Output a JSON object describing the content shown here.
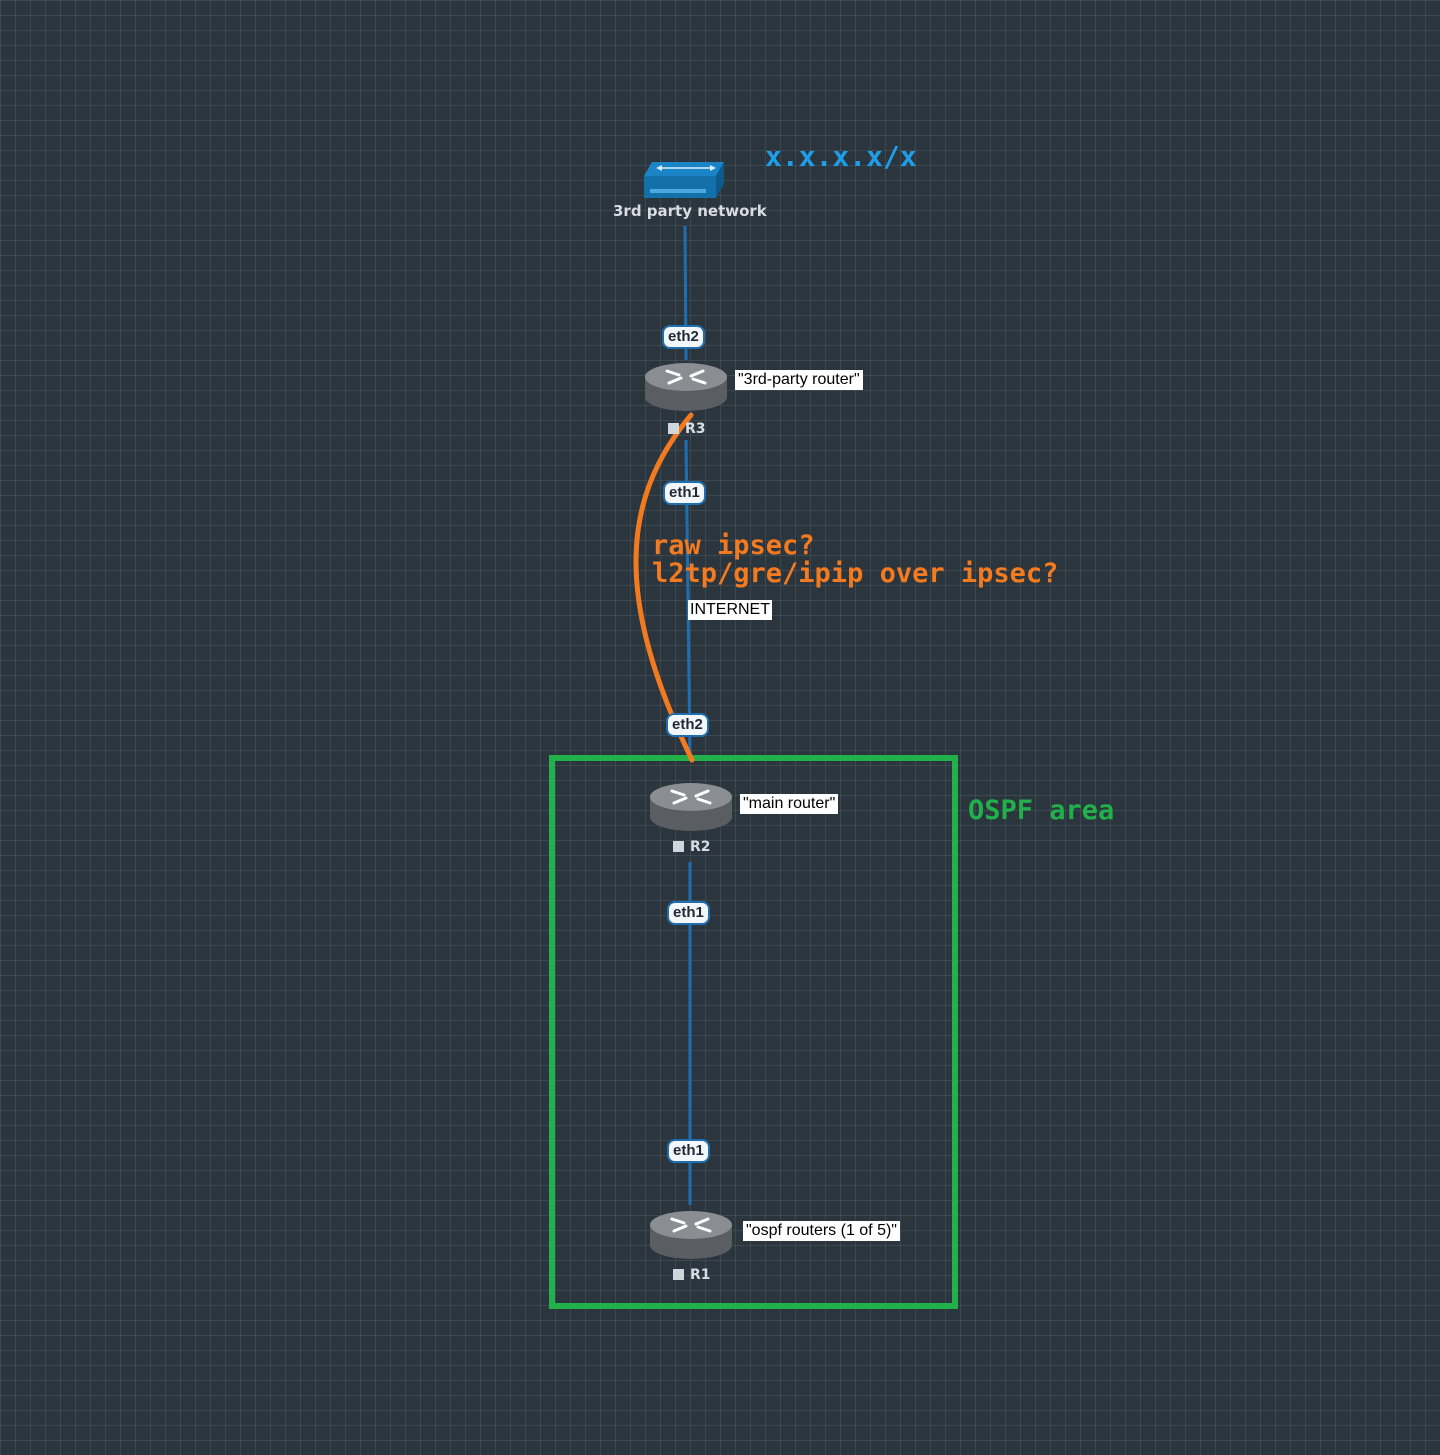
{
  "network": {
    "label": "3rd party network",
    "subnet": "x.x.x.x/x"
  },
  "routers": [
    {
      "id": "R3",
      "description": "\"3rd-party router\""
    },
    {
      "id": "R2",
      "description": "\"main router\""
    },
    {
      "id": "R1",
      "description": "\"ospf routers (1 of 5)\""
    }
  ],
  "interfaces": {
    "r3_top": "eth2",
    "r3_bottom": "eth1",
    "r2_top": "eth2",
    "r2_bottom": "eth1",
    "r1_top": "eth1"
  },
  "link_label": "INTERNET",
  "tunnel_question": {
    "line1": "raw ipsec?",
    "line2": "l2tp/gre/ipip over ipsec?"
  },
  "ospf_area_label": "OSPF area",
  "colors": {
    "background": "#2b353d",
    "link": "#1f6fb0",
    "tunnel": "#f47a20",
    "ospf": "#22b04a",
    "subnet_text": "#1e9ee8"
  },
  "icons": {
    "network": "switch-icon",
    "router": "router-icon"
  }
}
